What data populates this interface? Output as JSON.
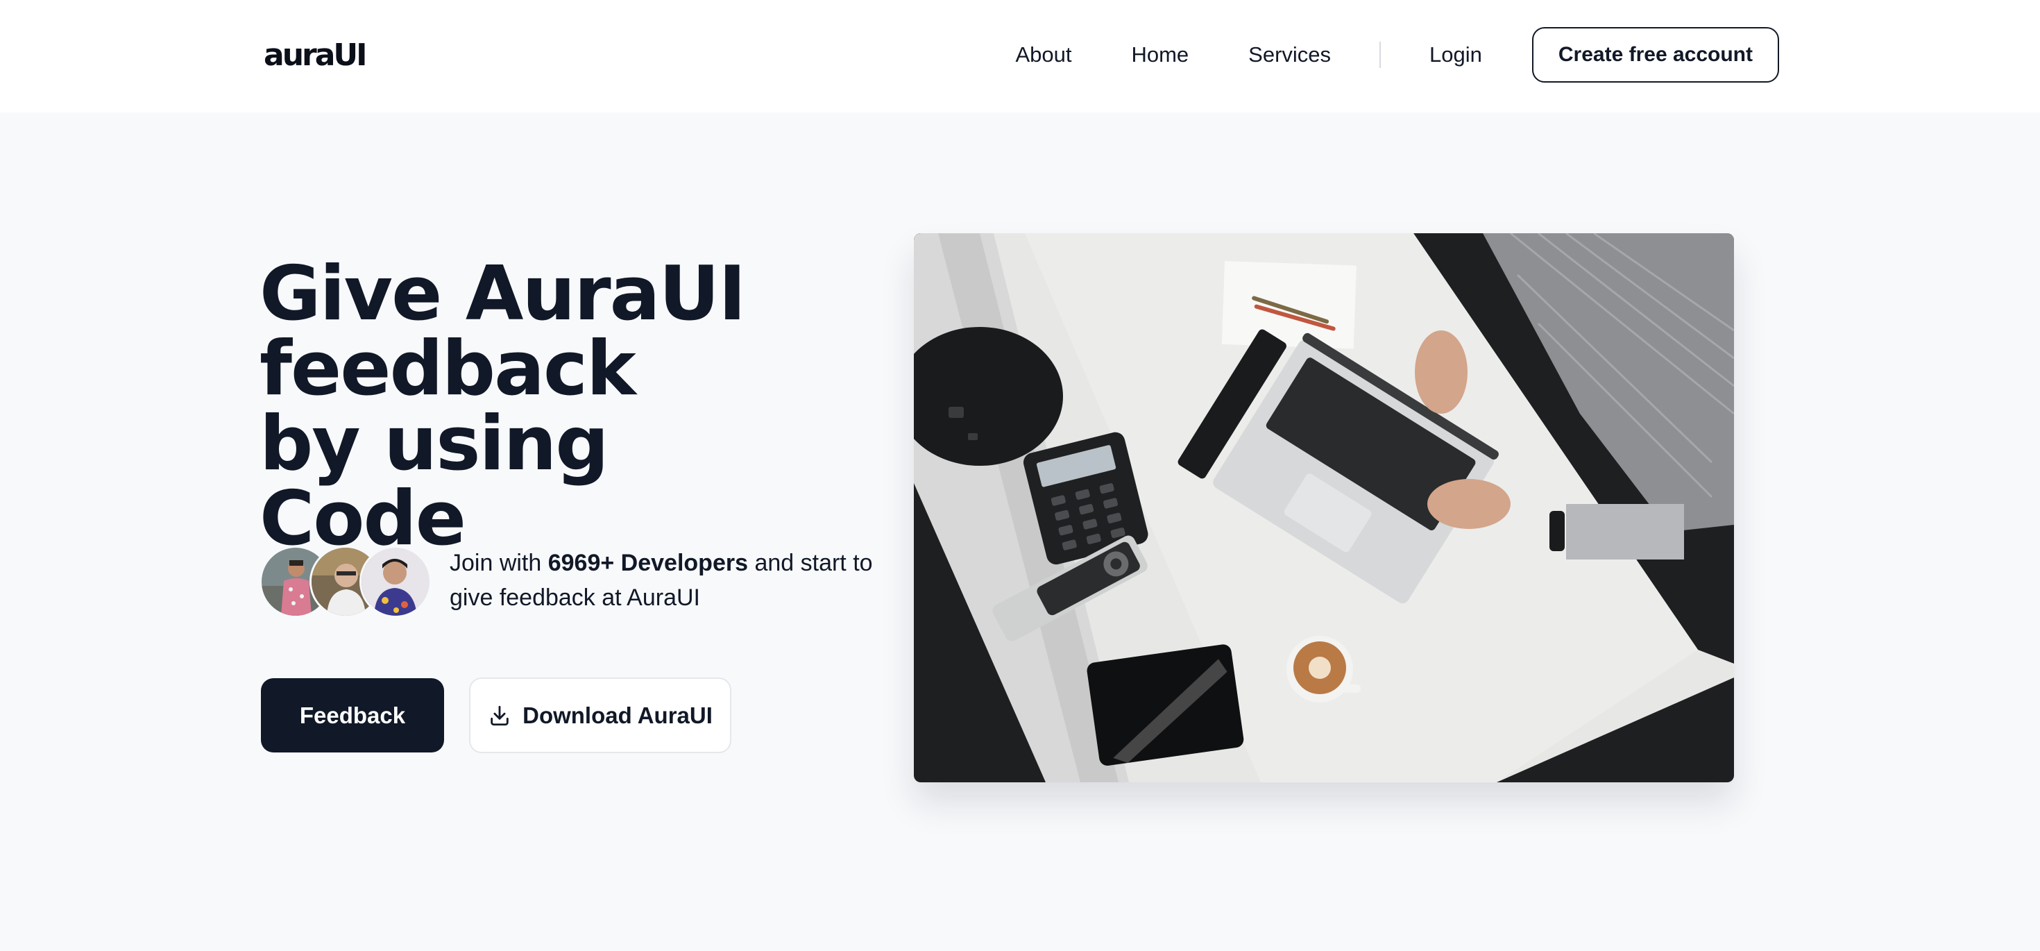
{
  "header": {
    "logo_text": "auraUI",
    "nav": [
      {
        "label": "About"
      },
      {
        "label": "Home"
      },
      {
        "label": "Services"
      }
    ],
    "login_label": "Login",
    "cta_label": "Create free account"
  },
  "hero": {
    "headline": "Give AuraUI feedback by using Code",
    "join_prefix": "Join with",
    "join_count": "6969+ Developers",
    "join_suffix": "and start to give feedback at AuraUI",
    "primary_button": "Feedback",
    "secondary_button": "Download AuraUI",
    "secondary_icon": "download-icon"
  },
  "colors": {
    "text": "#111827",
    "page_background": "#f8f9fb",
    "header_background": "#ffffff",
    "primary_button": "#111827"
  }
}
